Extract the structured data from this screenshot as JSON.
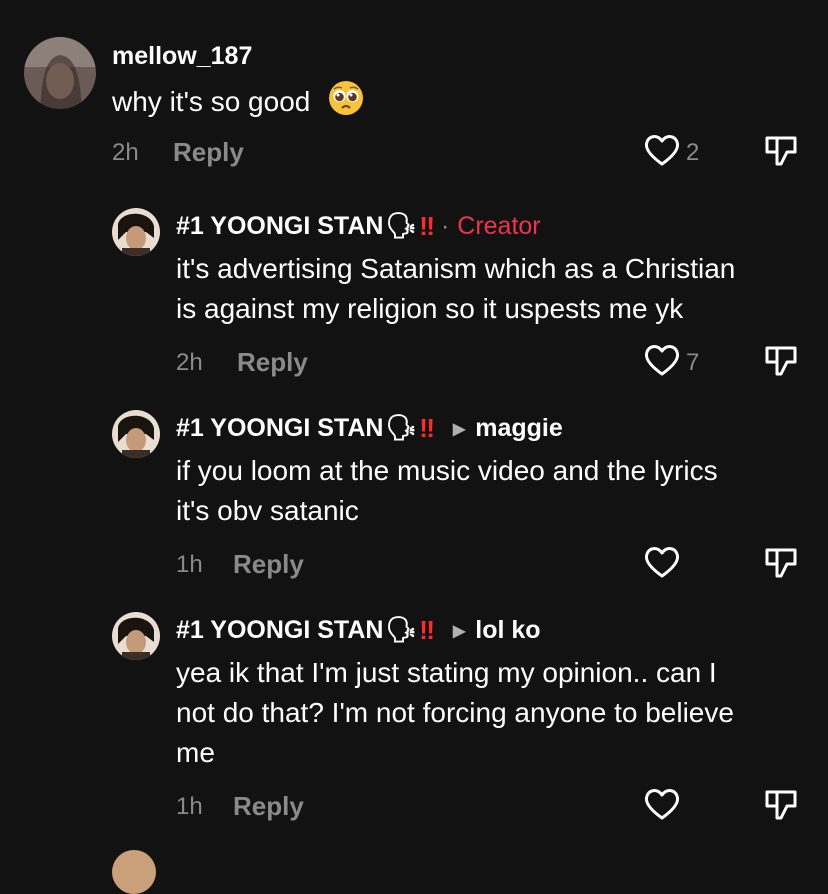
{
  "comments": [
    {
      "username": "mellow_187",
      "text_lines": [
        "why it's so good"
      ],
      "emoji": "pleading-face",
      "time": "2h",
      "reply_label": "Reply",
      "likes": "2"
    },
    {
      "username": "#1 YOONGI STAN",
      "separator": "·",
      "creator_label": "Creator",
      "text_lines": [
        "it's advertising Satanism which as a Christian",
        "is against my religion so it uspests me yk"
      ],
      "time": "2h",
      "reply_label": "Reply",
      "likes": "7"
    },
    {
      "username": "#1 YOONGI STAN",
      "reply_to": "maggie",
      "text_lines": [
        "if you loom at the music video and the lyrics",
        "it's obv satanic"
      ],
      "time": "1h",
      "reply_label": "Reply",
      "likes": ""
    },
    {
      "username": "#1 YOONGI STAN",
      "reply_to": "lol ko",
      "text_lines": [
        "yea ik that I'm just stating my opinion.. can I",
        "not do that? I'm not forcing anyone to believe",
        "me"
      ],
      "time": "1h",
      "reply_label": "Reply",
      "likes": ""
    }
  ],
  "glyphs": {
    "speaking_head": "🗣",
    "double_exclamation": "‼",
    "reply_arrow": "▶"
  },
  "colors": {
    "background": "#121212",
    "muted": "#8a8a8a",
    "creator": "#f0334f",
    "exclamation": "#ff2a2a"
  }
}
